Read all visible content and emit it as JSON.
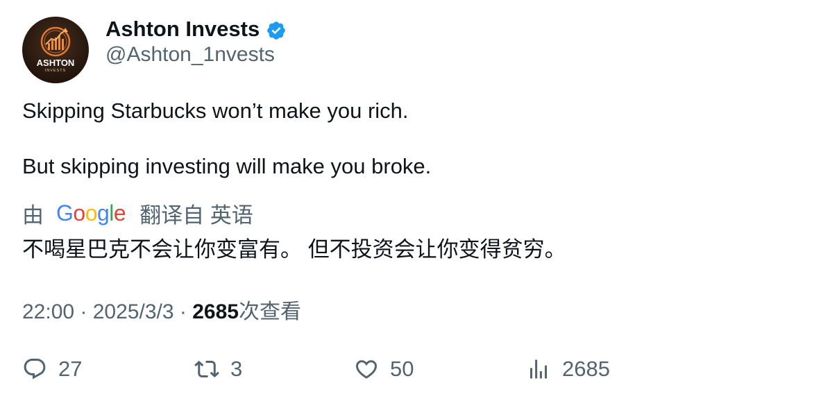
{
  "author": {
    "display_name": "Ashton Invests",
    "handle": "@Ashton_1nvests",
    "verified": true,
    "verified_color": "#1d9bf0",
    "avatar_text": "ASHTON",
    "avatar_subtext": "INVESTS"
  },
  "tweet": {
    "line1": "Skipping Starbucks won’t make you rich.",
    "line2": "But skipping investing will make you broke."
  },
  "translation": {
    "prefix": "由",
    "provider_letters": [
      {
        "char": "G",
        "color": "#4285F4"
      },
      {
        "char": "o",
        "color": "#EA4335"
      },
      {
        "char": "o",
        "color": "#FBBC05"
      },
      {
        "char": "g",
        "color": "#4285F4"
      },
      {
        "char": "l",
        "color": "#34A853"
      },
      {
        "char": "e",
        "color": "#EA4335"
      }
    ],
    "suffix": "翻译自 英语",
    "text": "不喝星巴克不会让你变富有。 但不投资会让你变得贫穷。"
  },
  "meta": {
    "time": "22:00",
    "separator": "·",
    "date": "2025/3/3",
    "views_count": "2685",
    "views_label": "次查看"
  },
  "actions": {
    "replies": "27",
    "retweets": "3",
    "likes": "50",
    "views": "2685",
    "icons": [
      "reply-icon",
      "retweet-icon",
      "like-icon",
      "views-icon"
    ]
  }
}
